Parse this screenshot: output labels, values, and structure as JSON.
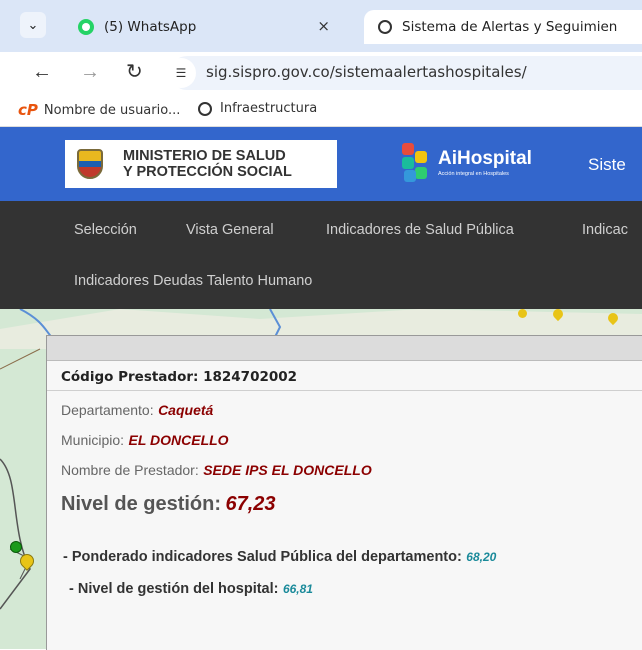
{
  "browser": {
    "tabs": [
      {
        "title": "(5) WhatsApp",
        "close": "×",
        "icon": "whatsapp-icon"
      },
      {
        "title": "Sistema de Alertas y Seguimien",
        "icon": "globe-icon"
      }
    ],
    "url": "sig.sispro.gov.co/sistemaalertashospitales/",
    "bookmarks": [
      {
        "label": "Nombre de usuario...",
        "icon": "cp-icon"
      },
      {
        "label": "Infraestructura",
        "icon": "globe-icon"
      }
    ]
  },
  "header": {
    "ministry_line1": "MINISTERIO DE SALUD",
    "ministry_line2": "Y PROTECCIÓN SOCIAL",
    "app_name": "AiHospital",
    "app_tagline": "Acción integral en Hospitales",
    "system_title": "Siste"
  },
  "nav": {
    "items": [
      "Selección",
      "Vista General",
      "Indicadores de Salud Pública",
      "Indicac"
    ],
    "row2": "Indicadores Deudas Talento Humano"
  },
  "popup": {
    "codigo_label": "Código Prestador: 1824702002",
    "departamento_label": "Departamento:",
    "departamento_value": "Caquetá",
    "municipio_label": "Municipio:",
    "municipio_value": "EL DONCELLO",
    "prestador_label": "Nombre de Prestador:",
    "prestador_value": "SEDE IPS EL DONCELLO",
    "nivel_label": "Nivel de gestión:",
    "nivel_value": "67,23",
    "ponderado_label": "- Ponderado indicadores Salud Pública del departamento:",
    "ponderado_value": "68,20",
    "hospital_label": "- Nivel de gestión del hospital:",
    "hospital_value": "66,81"
  },
  "colors": {
    "header_blue": "#3366cc",
    "nav_dark": "#333333",
    "value_red": "#8b0000",
    "indicator_teal": "#1a8a9a"
  }
}
